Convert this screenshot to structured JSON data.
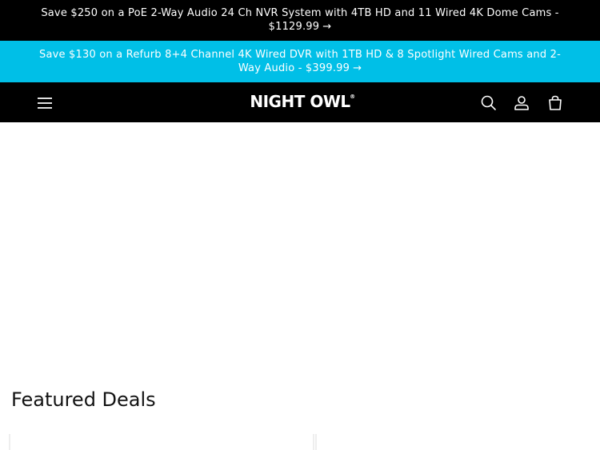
{
  "announcements": [
    {
      "text": "Save $250 on a PoE 2-Way Audio 24 Ch NVR System with 4TB HD and 11 Wired 4K Dome Cams - $1129.99",
      "arrow": "→"
    },
    {
      "text": "Save $130 on a Refurb 8+4 Channel 4K Wired DVR with 1TB HD & 8 Spotlight Wired Cams and 2-Way Audio - $399.99",
      "arrow": "→"
    }
  ],
  "header": {
    "logo_text": "NIGHT OWL",
    "logo_mark": "®",
    "icons": {
      "menu": "hamburger-menu-icon",
      "search": "search-icon",
      "account": "account-icon",
      "cart": "cart-icon"
    }
  },
  "featured": {
    "title": "Featured Deals"
  },
  "colors": {
    "top_bar": "#000000",
    "promo_bar": "#00bfe7",
    "header": "#000000",
    "text_dark": "#121212"
  }
}
